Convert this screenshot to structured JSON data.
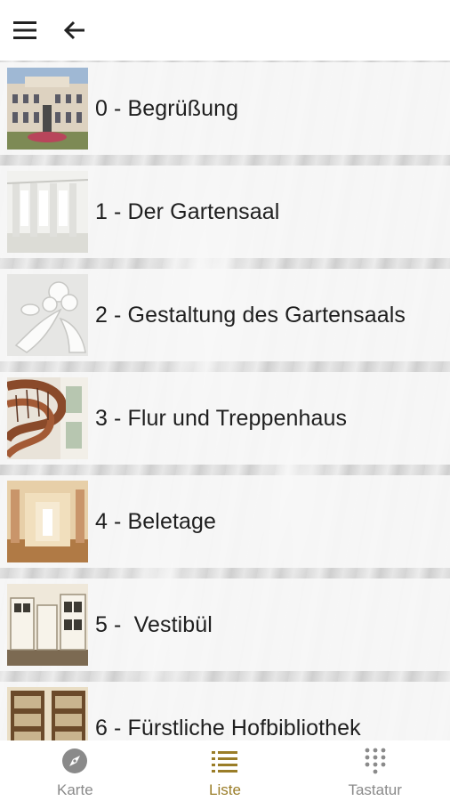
{
  "app_bar": {
    "menu_icon": "menu-icon",
    "back_icon": "arrow-back-icon"
  },
  "list": {
    "items": [
      {
        "label": "0 - Begrüßung",
        "thumb": "palace-facade"
      },
      {
        "label": "1 - Der Gartensaal",
        "thumb": "white-hall"
      },
      {
        "label": "2 - Gestaltung des Gartensaals",
        "thumb": "stucco-ornament"
      },
      {
        "label": "3 - Flur und Treppenhaus",
        "thumb": "spiral-staircase"
      },
      {
        "label": "4 - Beletage",
        "thumb": "enfilade-corridor"
      },
      {
        "label": "5 -  Vestibül",
        "thumb": "vestibule-cabinets"
      },
      {
        "label": "6 - Fürstliche Hofbibliothek",
        "thumb": "library-shelves"
      }
    ]
  },
  "bottom_nav": {
    "items": [
      {
        "label": "Karte",
        "icon": "compass-icon",
        "active": false
      },
      {
        "label": "Liste",
        "icon": "list-icon",
        "active": true
      },
      {
        "label": "Tastatur",
        "icon": "dialpad-icon",
        "active": false
      }
    ]
  },
  "colors": {
    "accent": "#9a7d28",
    "inactive": "#8a8a8a",
    "text": "#1f1f1f"
  }
}
